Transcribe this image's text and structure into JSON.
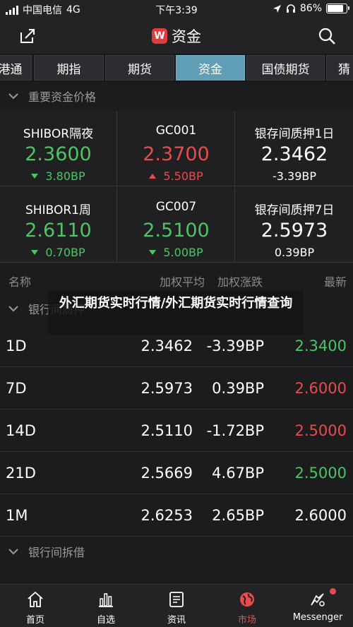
{
  "status_bar": {
    "carrier": "中国电信",
    "network": "4G",
    "time": "下午3:39",
    "battery_text": "86%",
    "battery_level": 0.86
  },
  "nav": {
    "logo_letter": "W",
    "title": "资金"
  },
  "tabs": [
    {
      "label": "港通"
    },
    {
      "label": "期指"
    },
    {
      "label": "期货"
    },
    {
      "label": "资金",
      "active": true
    },
    {
      "label": "国债期货"
    },
    {
      "label": "猜"
    }
  ],
  "section_rates": {
    "title": "重要资金价格",
    "cells": [
      {
        "name": "SHIBOR隔夜",
        "value": "2.3600",
        "change": "3.80BP",
        "trend": "down"
      },
      {
        "name": "GC001",
        "value": "2.3700",
        "change": "5.50BP",
        "trend": "up"
      },
      {
        "name": "银存间质押1日",
        "value": "2.3462",
        "change": "-3.39BP",
        "trend": "flat"
      },
      {
        "name": "SHIBOR1周",
        "value": "2.6110",
        "change": "0.70BP",
        "trend": "down"
      },
      {
        "name": "GC007",
        "value": "2.5100",
        "change": "5.00BP",
        "trend": "down"
      },
      {
        "name": "银存间质押7日",
        "value": "2.5973",
        "change": "0.39BP",
        "trend": "flat"
      }
    ]
  },
  "columns": {
    "name": "名称",
    "avg": "加权平均",
    "change": "加权涨跌",
    "latest": "最新"
  },
  "section_pledge": {
    "title": "银行间质押"
  },
  "rows": [
    {
      "term": "1D",
      "avg": "2.3462",
      "change": "-3.39BP",
      "latest": "2.3400",
      "latest_color": "green"
    },
    {
      "term": "7D",
      "avg": "2.5973",
      "change": "0.39BP",
      "latest": "2.6000",
      "latest_color": "red"
    },
    {
      "term": "14D",
      "avg": "2.5110",
      "change": "-1.72BP",
      "latest": "2.5000",
      "latest_color": "red"
    },
    {
      "term": "21D",
      "avg": "2.5669",
      "change": "4.67BP",
      "latest": "2.5000",
      "latest_color": "green"
    },
    {
      "term": "1M",
      "avg": "2.6253",
      "change": "2.65BP",
      "latest": "2.6000",
      "latest_color": "white"
    }
  ],
  "section_lending": {
    "title": "银行间拆借"
  },
  "overlay": {
    "text": "外汇期货实时行情/外汇期货实时行情查询"
  },
  "bottom_tabs": [
    {
      "label": "首页",
      "icon": "home-icon"
    },
    {
      "label": "自选",
      "icon": "chart-bars-icon"
    },
    {
      "label": "资讯",
      "icon": "news-icon"
    },
    {
      "label": "市场",
      "icon": "globe-icon",
      "active": true
    },
    {
      "label": "Messenger",
      "icon": "messenger-icon",
      "badge": true
    }
  ],
  "colors": {
    "up": "#e84b4b",
    "down": "#4cc464",
    "accent_tab": "#5f9eb4",
    "background": "#1c1c1e"
  }
}
